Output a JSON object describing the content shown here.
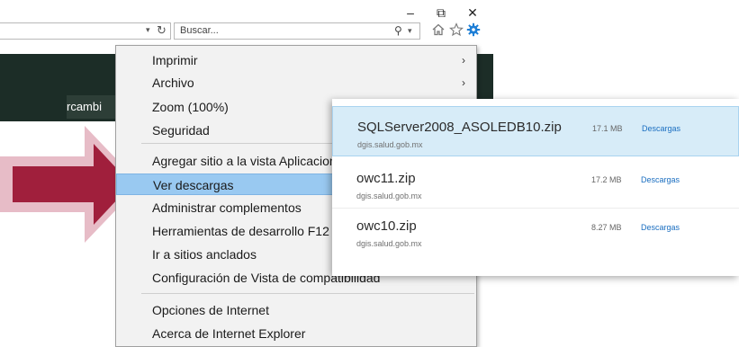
{
  "window": {
    "minimize_glyph": "–",
    "restore_glyph": "⧉",
    "close_glyph": "✕"
  },
  "address_bar": {
    "dropdown_glyph": "▾",
    "refresh_glyph": "↻"
  },
  "search": {
    "placeholder": "Buscar...",
    "icon_glyph": "⚲",
    "chevron_glyph": "▾"
  },
  "toolbar": {
    "icons": [
      "home-icon",
      "favorites-star-icon",
      "tools-gear-icon"
    ]
  },
  "page": {
    "partial_text": "rcambi"
  },
  "tools_menu": {
    "items": [
      {
        "label": "Imprimir",
        "has_submenu": true
      },
      {
        "label": "Archivo",
        "has_submenu": true
      },
      {
        "label": "Zoom (100%)",
        "has_submenu": true
      },
      {
        "label": "Seguridad",
        "has_submenu": true
      },
      {
        "label": "Agregar sitio a la vista Aplicaciones",
        "has_submenu": false
      },
      {
        "label": "Ver descargas",
        "has_submenu": false,
        "highlighted": true
      },
      {
        "label": "Administrar complementos",
        "has_submenu": false
      },
      {
        "label": "Herramientas de desarrollo F12",
        "has_submenu": false
      },
      {
        "label": "Ir a sitios anclados",
        "has_submenu": false
      },
      {
        "label": "Configuración de Vista de compatibilidad",
        "has_submenu": false
      },
      {
        "label": "Opciones de Internet",
        "has_submenu": false
      },
      {
        "label": "Acerca de Internet Explorer",
        "has_submenu": false
      }
    ],
    "submenu_glyph": "›"
  },
  "downloads": {
    "items": [
      {
        "name": "SQLServer2008_ASOLEDB10.zip",
        "site": "dgis.salud.gob.mx",
        "size": "17.1 MB",
        "location": "Descargas"
      },
      {
        "name": "owc11.zip",
        "site": "dgis.salud.gob.mx",
        "size": "17.2 MB",
        "location": "Descargas"
      },
      {
        "name": "owc10.zip",
        "site": "dgis.salud.gob.mx",
        "size": "8.27 MB",
        "location": "Descargas"
      }
    ]
  },
  "colors": {
    "arrow": "#a01f3c",
    "arrow_halo": "#e7bcc7",
    "menu_highlight": "#99c9f1",
    "download_active": "#d7ecf8",
    "link": "#1a6ec0",
    "page_band": "#1c2d27",
    "gear_icon": "#1e7fd6"
  }
}
